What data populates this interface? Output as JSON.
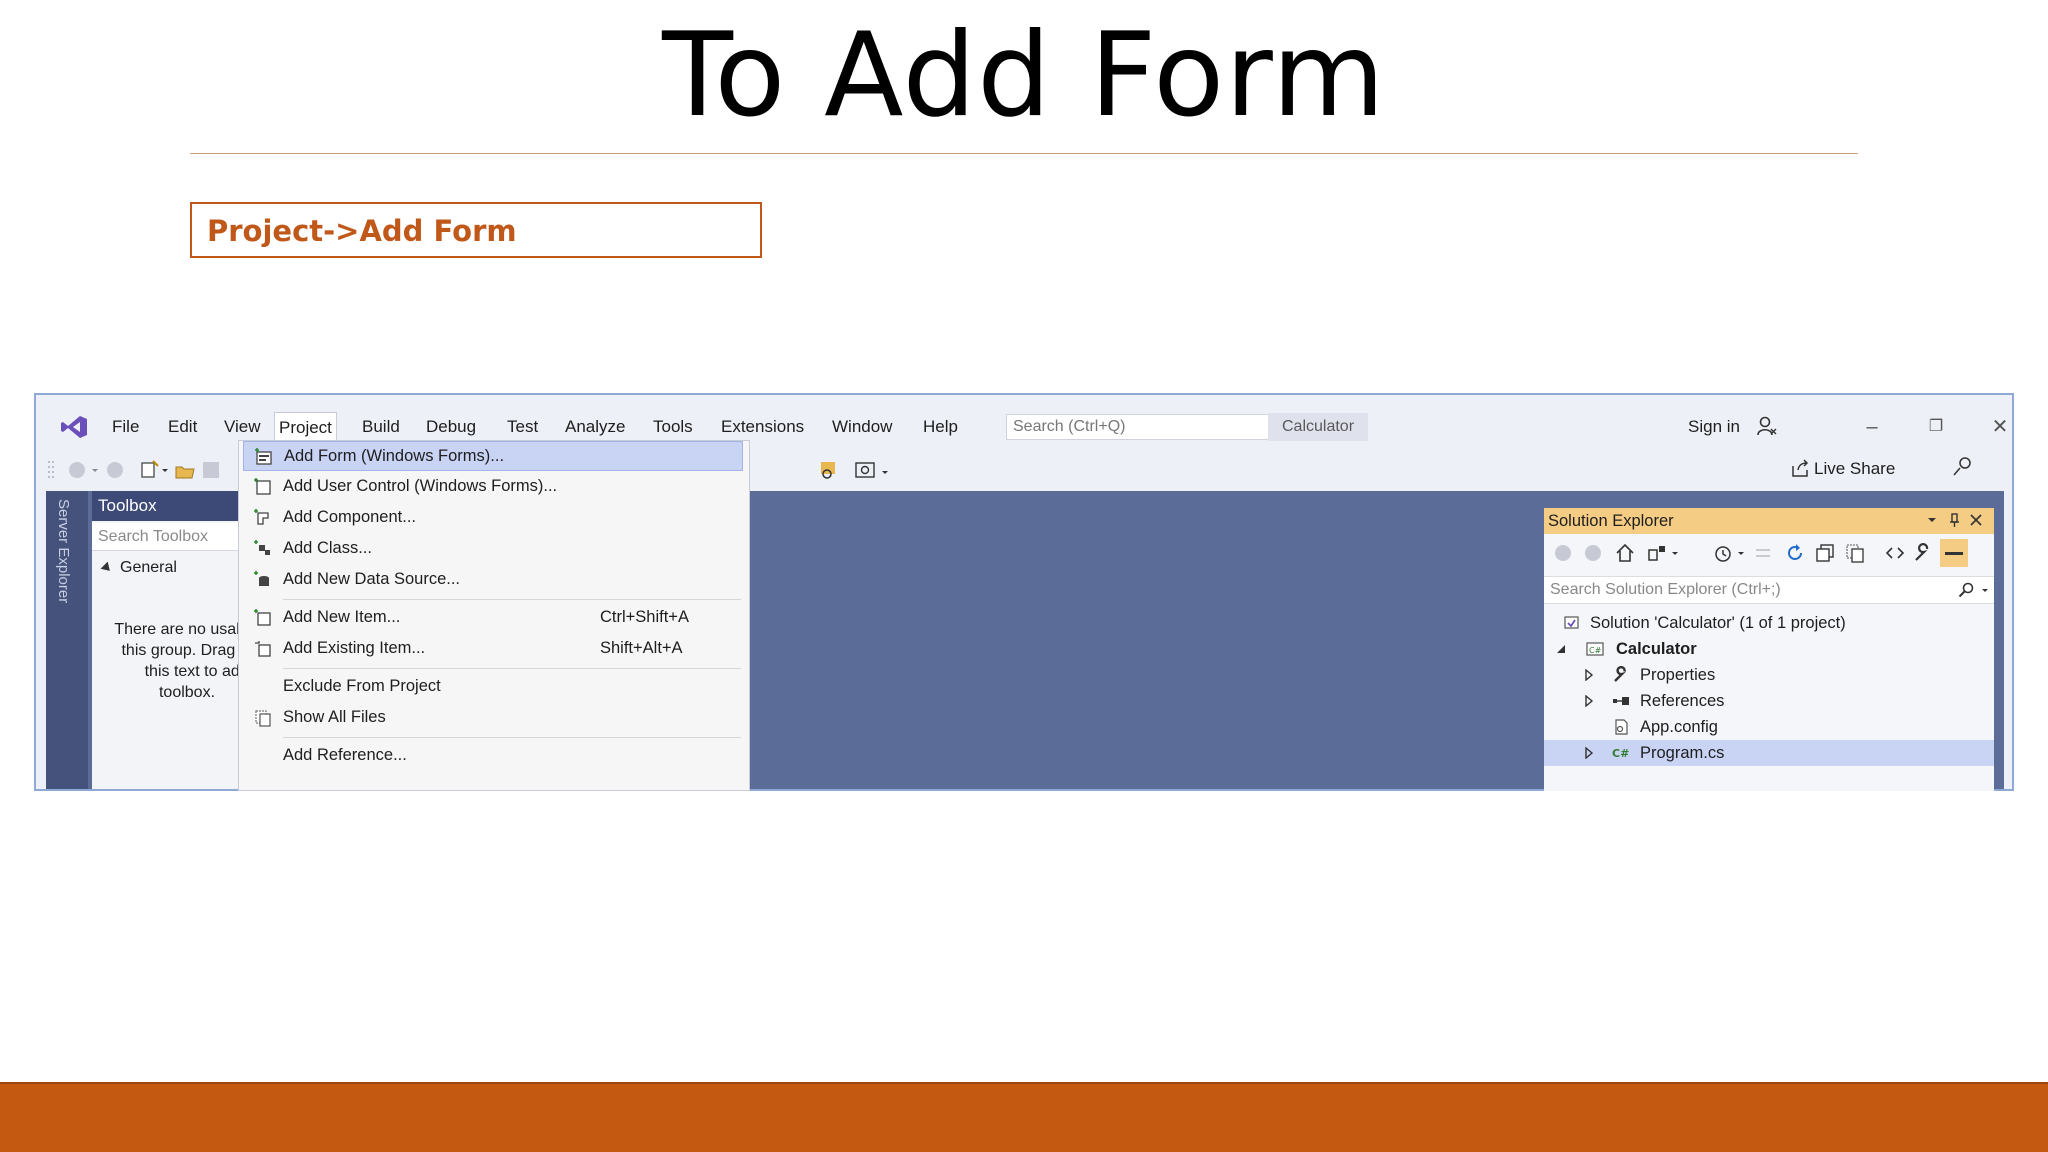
{
  "slide": {
    "title": "To Add Form",
    "callout": "Project->Add Form"
  },
  "menubar": {
    "items": [
      "File",
      "Edit",
      "View",
      "Project",
      "Build",
      "Debug",
      "Test",
      "Analyze",
      "Tools",
      "Extensions",
      "Window",
      "Help"
    ],
    "search_placeholder": "Search (Ctrl+Q)",
    "solution_name": "Calculator",
    "sign_in": "Sign in",
    "live_share": "Live Share"
  },
  "server_explorer": {
    "label": "Server Explorer"
  },
  "toolbox": {
    "title": "Toolbox",
    "search_placeholder": "Search Toolbox",
    "group": "General",
    "empty_lines": [
      "There are no usable c",
      "this group. Drag an it",
      "this text to add it t",
      "toolbox."
    ]
  },
  "project_menu": {
    "items": [
      {
        "label": "Add Form (Windows Forms)...",
        "shortcut": "",
        "icon": "form-icon",
        "highlighted": true
      },
      {
        "label": "Add User Control (Windows Forms)...",
        "shortcut": "",
        "icon": "user-control-icon"
      },
      {
        "label": "Add Component...",
        "shortcut": "",
        "icon": "component-icon"
      },
      {
        "label": "Add Class...",
        "shortcut": "",
        "icon": "class-icon"
      },
      {
        "label": "Add New Data Source...",
        "shortcut": "",
        "icon": "data-source-icon"
      },
      {
        "label": "Add New Item...",
        "shortcut": "Ctrl+Shift+A",
        "icon": "new-item-icon"
      },
      {
        "label": "Add Existing Item...",
        "shortcut": "Shift+Alt+A",
        "icon": "existing-item-icon"
      },
      {
        "label": "Exclude From Project",
        "shortcut": "",
        "icon": ""
      },
      {
        "label": "Show All Files",
        "shortcut": "",
        "icon": "show-all-files-icon"
      },
      {
        "label": "Add Reference...",
        "shortcut": "",
        "icon": ""
      }
    ]
  },
  "solution_explorer": {
    "title": "Solution Explorer",
    "search_placeholder": "Search Solution Explorer (Ctrl+;)",
    "tree": [
      {
        "label": "Solution 'Calculator' (1 of 1 project)",
        "icon": "solution-icon",
        "level": 0,
        "expander": "none"
      },
      {
        "label": "Calculator",
        "icon": "csharp-project-icon",
        "level": 1,
        "expander": "expanded",
        "bold": true
      },
      {
        "label": "Properties",
        "icon": "wrench-icon",
        "level": 2,
        "expander": "collapsed"
      },
      {
        "label": "References",
        "icon": "references-icon",
        "level": 2,
        "expander": "collapsed"
      },
      {
        "label": "App.config",
        "icon": "config-file-icon",
        "level": 2,
        "expander": "none"
      },
      {
        "label": "Program.cs",
        "icon": "csharp-file-icon",
        "level": 2,
        "expander": "collapsed",
        "selected": true
      }
    ]
  },
  "colors": {
    "accent": "#c0581a",
    "footer": "#c45911",
    "workspace": "#5c6c98",
    "menu_highlight": "#c9d4f5",
    "solution_explorer_header": "#f5cc84"
  }
}
